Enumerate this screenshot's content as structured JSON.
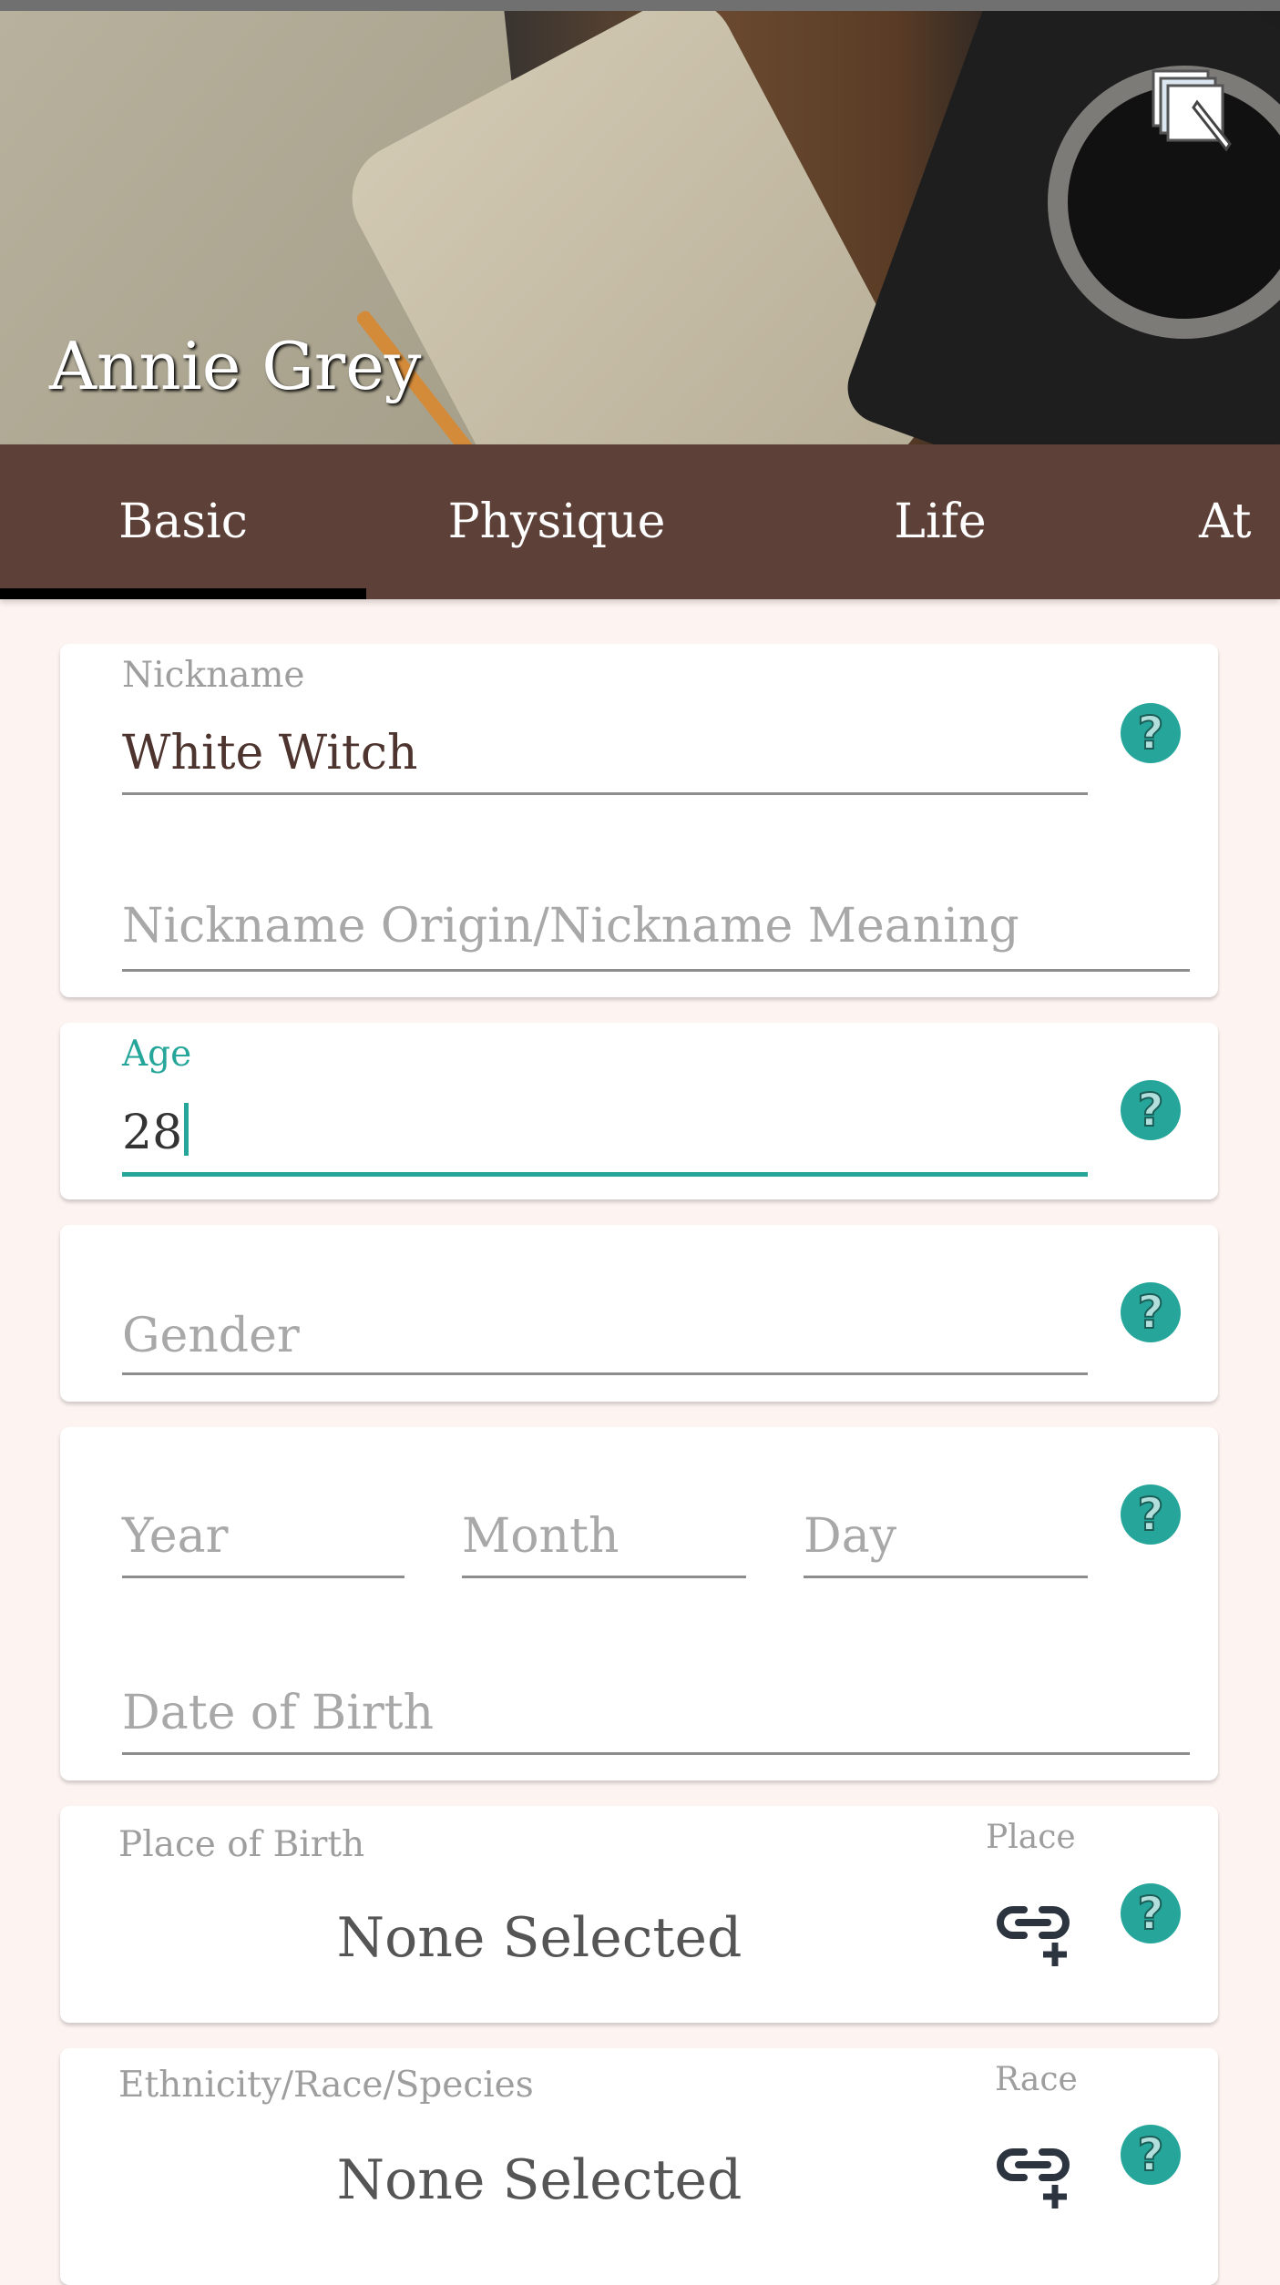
{
  "header": {
    "title": "Annie Grey",
    "edit_icon": "edit-pages-icon"
  },
  "tabs": [
    {
      "label": "Basic",
      "active": true
    },
    {
      "label": "Physique"
    },
    {
      "label": "Life"
    },
    {
      "label": "At"
    }
  ],
  "accent": "#26a69a",
  "tab_bar_color": "#5d4037",
  "nickname": {
    "label": "Nickname",
    "value": "White Witch",
    "origin_placeholder": "Nickname Origin/Nickname Meaning"
  },
  "age": {
    "label": "Age",
    "value": "28"
  },
  "gender": {
    "placeholder": "Gender"
  },
  "dob": {
    "year_placeholder": "Year",
    "month_placeholder": "Month",
    "day_placeholder": "Day",
    "placeholder": "Date of Birth"
  },
  "place_of_birth": {
    "label": "Place of Birth",
    "link_label": "Place",
    "value": "None Selected"
  },
  "ethnicity": {
    "label": "Ethnicity/Race/Species",
    "link_label": "Race",
    "value": "None Selected"
  },
  "help_symbol": "?"
}
